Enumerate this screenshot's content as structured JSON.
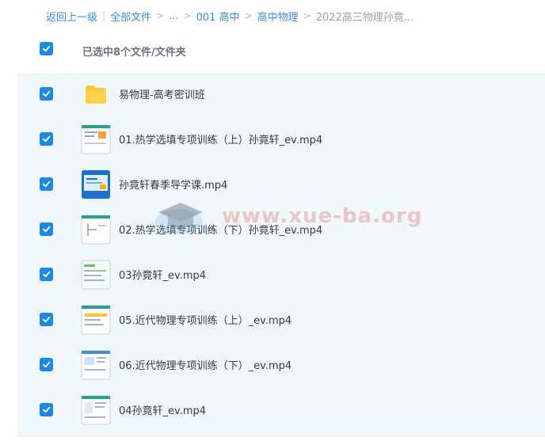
{
  "breadcrumb": {
    "back": "返回上一级",
    "pipe": "|",
    "items": [
      "全部文件",
      "...",
      "001 高中",
      "高中物理"
    ],
    "current": "2022高三物理孙竟...",
    "sep": ">"
  },
  "selection": {
    "label": "已选中8个文件/文件夹"
  },
  "files": [
    {
      "name": "易物理-高考密训班",
      "type": "folder"
    },
    {
      "name": "01.热学选填专项训练（上）孙竟轩_ev.mp4",
      "type": "video"
    },
    {
      "name": "孙竟轩春季导学课.mp4",
      "type": "video"
    },
    {
      "name": "02.热学选填专项训练（下）孙竟轩_ev.mp4",
      "type": "video"
    },
    {
      "name": "03孙竟轩_ev.mp4",
      "type": "video"
    },
    {
      "name": "05.近代物理专项训练（上）_ev.mp4",
      "type": "video"
    },
    {
      "name": "06.近代物理专项训练（下）_ev.mp4",
      "type": "video"
    },
    {
      "name": "04孙竟轩_ev.mp4",
      "type": "video"
    }
  ],
  "watermark": {
    "text": "www.xue-ba.org"
  },
  "colors": {
    "accent": "#1e88e5",
    "link": "#3b8ee6",
    "list_bg": "#f0f8fc",
    "folder": "#ffc933"
  }
}
